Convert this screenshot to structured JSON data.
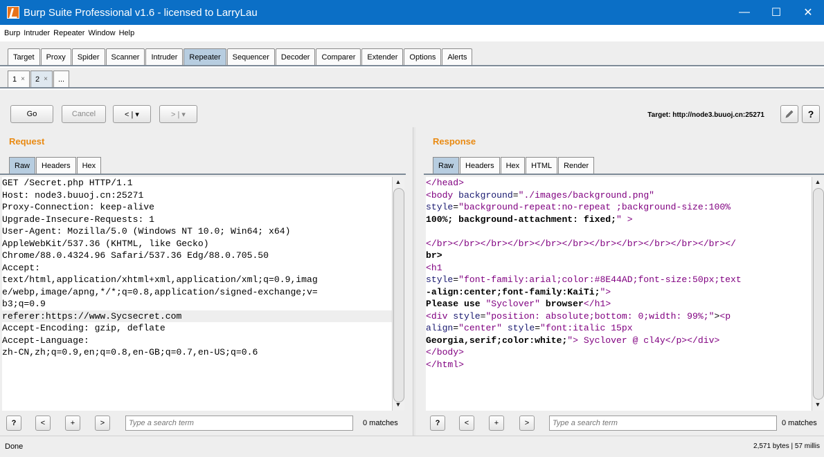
{
  "window": {
    "title": "Burp Suite Professional v1.6 - licensed to LarryLau",
    "minimize": "—",
    "maximize": "☐",
    "close": "✕"
  },
  "menu": [
    "Burp",
    "Intruder",
    "Repeater",
    "Window",
    "Help"
  ],
  "main_tabs": [
    {
      "label": "Target"
    },
    {
      "label": "Proxy"
    },
    {
      "label": "Spider"
    },
    {
      "label": "Scanner"
    },
    {
      "label": "Intruder"
    },
    {
      "label": "Repeater",
      "active": true
    },
    {
      "label": "Sequencer"
    },
    {
      "label": "Decoder"
    },
    {
      "label": "Comparer"
    },
    {
      "label": "Extender"
    },
    {
      "label": "Options"
    },
    {
      "label": "Alerts"
    }
  ],
  "repeater_tabs": [
    {
      "label": "1",
      "close": "×"
    },
    {
      "label": "2",
      "close": "×",
      "active": true
    },
    {
      "label": "..."
    }
  ],
  "toolbar": {
    "go": "Go",
    "cancel": "Cancel",
    "back": "< | ▾",
    "forward": "> | ▾",
    "target_label": "Target: http://node3.buuoj.cn:25271",
    "help": "?"
  },
  "request": {
    "title": "Request",
    "tabs": [
      "Raw",
      "Headers",
      "Hex"
    ],
    "lines": [
      "GET /Secret.php HTTP/1.1",
      "Host: node3.buuoj.cn:25271",
      "Proxy-Connection: keep-alive",
      "Upgrade-Insecure-Requests: 1",
      "User-Agent: Mozilla/5.0 (Windows NT 10.0; Win64; x64)",
      "AppleWebKit/537.36 (KHTML, like Gecko)",
      "Chrome/88.0.4324.96 Safari/537.36 Edg/88.0.705.50",
      "Accept:",
      "text/html,application/xhtml+xml,application/xml;q=0.9,imag",
      "e/webp,image/apng,*/*;q=0.8,application/signed-exchange;v=",
      "b3;q=0.9",
      "referer:https://www.Sycsecret.com",
      "Accept-Encoding: gzip, deflate",
      "Accept-Language:",
      "zh-CN,zh;q=0.9,en;q=0.8,en-GB;q=0.7,en-US;q=0.6"
    ],
    "highlight_line": 11
  },
  "response": {
    "title": "Response",
    "tabs": [
      "Raw",
      "Headers",
      "Hex",
      "HTML",
      "Render"
    ],
    "lines": [
      "</head>",
      "<body background=\"./images/background.png\"",
      "style=\"background-repeat:no-repeat ;background-size:100%",
      "100%; background-attachment: fixed;\" >",
      "",
      "</br></br></br></br></br></br></br></br></br></br></br></",
      "br>",
      "<h1",
      "style=\"font-family:arial;color:#8E44AD;font-size:50px;text",
      "-align:center;font-family:KaiTi;\">",
      "Please use \"Syclover\" browser</h1>",
      "<div style=\"position: absolute;bottom: 0;width: 99%;\"><p",
      "align=\"center\" style=\"font:italic 15px",
      "Georgia,serif;color:white;\"> Syclover @ cl4y</p></div>",
      "</body>",
      "</html>"
    ]
  },
  "search": {
    "help": "?",
    "prev": "<",
    "add": "+",
    "next": ">",
    "placeholder": "Type a search term",
    "matches": "0 matches"
  },
  "status": {
    "left": "Done",
    "right": "2,571 bytes | 57 millis"
  }
}
